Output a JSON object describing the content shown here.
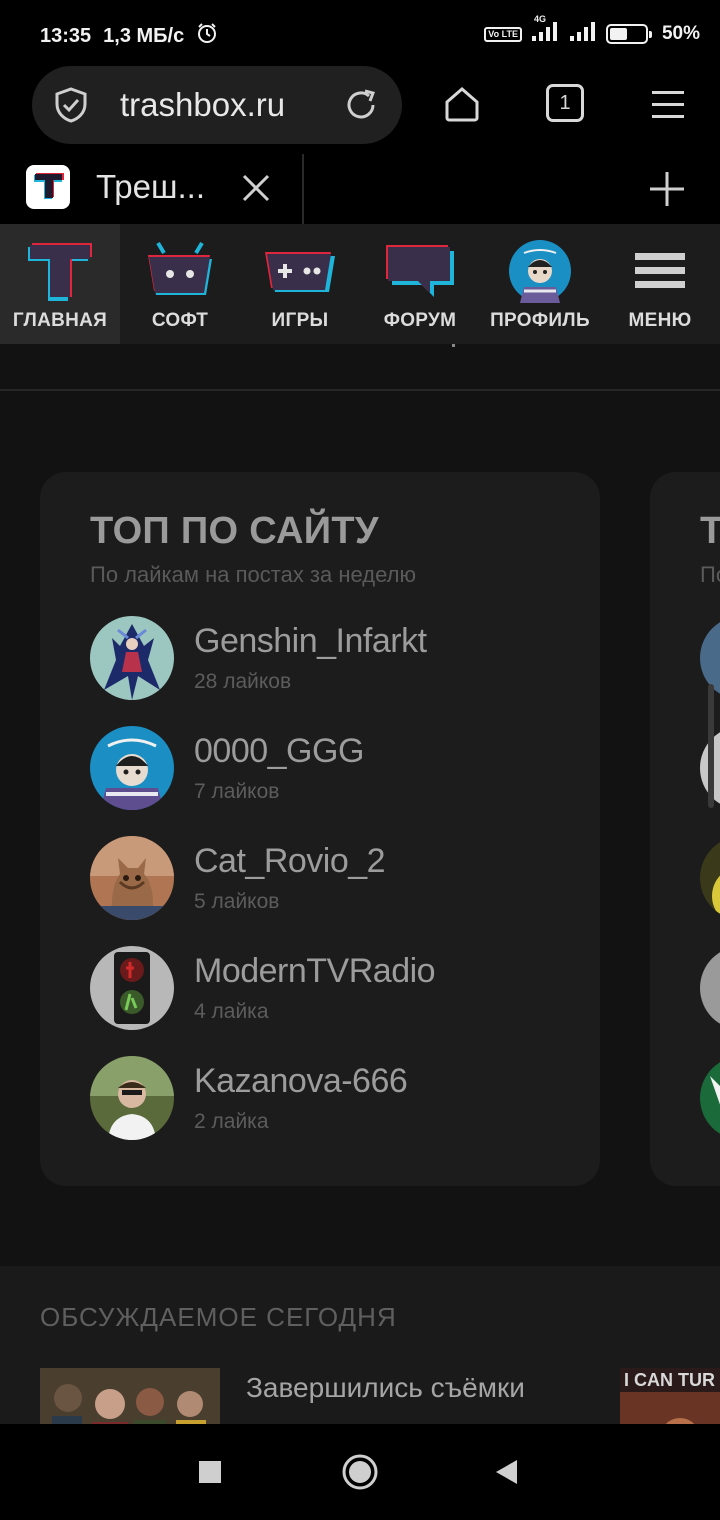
{
  "status_bar": {
    "time": "13:35",
    "speed": "1,3 МБ/с",
    "network": "4G",
    "volte": "Vo LTE",
    "battery": "50%",
    "battery_level": 0.5
  },
  "browser": {
    "url": "trashbox.ru",
    "tab_count": "1",
    "tab_title": "Треш..."
  },
  "site_nav": [
    {
      "label": "ГЛАВНАЯ",
      "icon": "trashbox-logo-icon",
      "active": true
    },
    {
      "label": "СОФТ",
      "icon": "android-robot-icon"
    },
    {
      "label": "ИГРЫ",
      "icon": "gamepad-icon"
    },
    {
      "label": "ФОРУМ",
      "icon": "speech-bubble-icon"
    },
    {
      "label": "ПРОФИЛЬ",
      "icon": "profile-avatar-icon"
    },
    {
      "label": "МЕНЮ",
      "icon": "hamburger-icon"
    }
  ],
  "top_card": {
    "title": "ТОП ПО САЙТУ",
    "subtitle": "По лайкам на постах за неделю",
    "users": [
      {
        "name": "Genshin_Infarkt",
        "likes": "28 лайков"
      },
      {
        "name": "0000_GGG",
        "likes": "7 лайков"
      },
      {
        "name": "Cat_Rovio_2",
        "likes": "5 лайков"
      },
      {
        "name": "ModernTVRadio",
        "likes": "4 лайка"
      },
      {
        "name": "Kazanova-666",
        "likes": "2 лайка"
      }
    ]
  },
  "peek_card": {
    "title": "Т",
    "subtitle": "По"
  },
  "discussed": {
    "heading": "ОБСУЖДАЕМОЕ СЕГОДНЯ",
    "item_title": "Завершились съёмки",
    "thumb2_text": "I CAN TUR"
  },
  "colors": {
    "accent_red": "#e0263c",
    "accent_blue": "#1fb4d9",
    "card_bg": "#1c1c1c",
    "page_bg": "#121212"
  }
}
